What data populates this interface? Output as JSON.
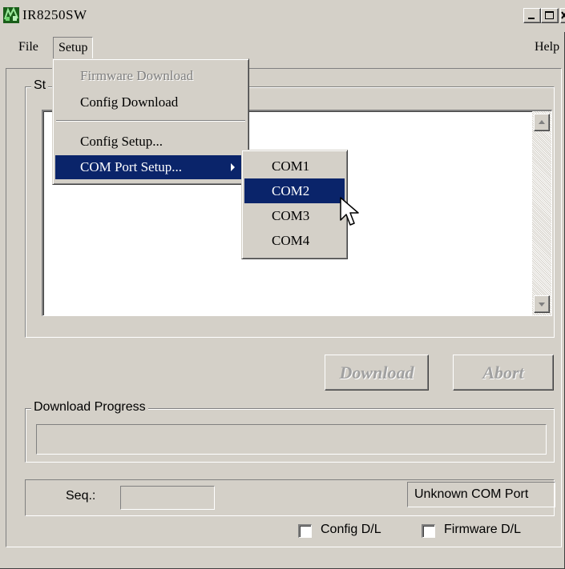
{
  "window": {
    "title": "IR8250SW",
    "buttons": {
      "minimize": "minimize",
      "maximize": "maximize",
      "close": "close"
    }
  },
  "menubar": {
    "file": "File",
    "setup": "Setup",
    "help": "Help"
  },
  "setup_menu": {
    "items": [
      {
        "label": "Firmware Download",
        "state": "disabled"
      },
      {
        "label": "Config Download",
        "state": "normal"
      },
      {
        "label": "Config Setup...",
        "state": "normal"
      },
      {
        "label": "COM Port Setup...",
        "state": "selected",
        "has_submenu": true
      }
    ]
  },
  "com_submenu": {
    "items": [
      {
        "label": "COM1",
        "state": "normal"
      },
      {
        "label": "COM2",
        "state": "selected"
      },
      {
        "label": "COM3",
        "state": "normal"
      },
      {
        "label": "COM4",
        "state": "normal"
      }
    ]
  },
  "status_group": {
    "label_partial": "St"
  },
  "buttons": {
    "download": "Download",
    "abort": "Abort"
  },
  "progress": {
    "label": "Download Progress",
    "value": 0
  },
  "statusbar": {
    "seq_label": "Seq.:",
    "com_port": "Unknown COM Port"
  },
  "checkboxes": {
    "config": {
      "label": "Config D/L",
      "checked": false
    },
    "firmware": {
      "label": "Firmware D/L",
      "checked": false
    }
  },
  "colors": {
    "face": "#d4d0c8",
    "highlight": "#0a246a",
    "disabled_text": "#808080"
  }
}
